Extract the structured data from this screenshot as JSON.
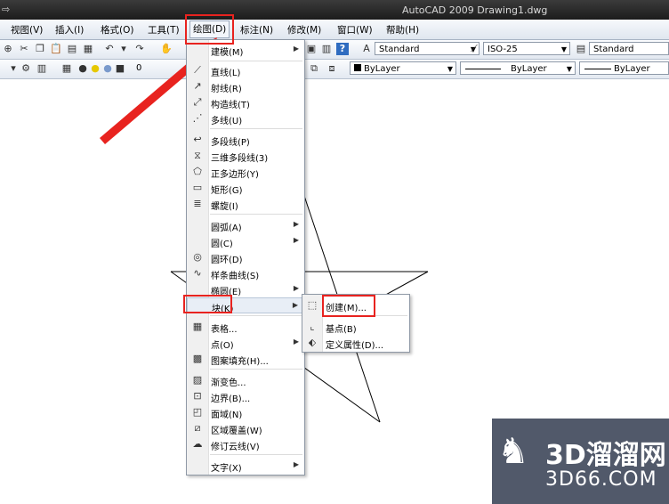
{
  "window": {
    "title": "AutoCAD 2009  Drawing1.dwg"
  },
  "menubar": {
    "items": [
      "视图(V)",
      "插入(I)",
      "格式(O)",
      "工具(T)",
      "绘图(D)",
      "标注(N)",
      "修改(M)",
      "窗口(W)",
      "帮助(H)"
    ],
    "active": "绘图(D)"
  },
  "toolbar1": {
    "text_style": "Standard",
    "dim_style": "ISO-25",
    "table_style": "Standard"
  },
  "toolbar2": {
    "layer_name": "0",
    "color": "ByLayer",
    "linetype": "ByLayer",
    "lineweight": "ByLayer"
  },
  "draw_menu": {
    "items": [
      {
        "label": "建模(M)",
        "icon": "modeling-icon",
        "submenu": true
      },
      {
        "label": "直线(L)",
        "icon": "line-icon"
      },
      {
        "label": "射线(R)",
        "icon": "ray-icon"
      },
      {
        "label": "构造线(T)",
        "icon": "construction-line-icon"
      },
      {
        "label": "多线(U)",
        "icon": "multiline-icon"
      },
      {
        "label": "多段线(P)",
        "icon": "polyline-icon"
      },
      {
        "label": "三维多段线(3)",
        "icon": "3d-polyline-icon"
      },
      {
        "label": "正多边形(Y)",
        "icon": "polygon-icon"
      },
      {
        "label": "矩形(G)",
        "icon": "rectangle-icon"
      },
      {
        "label": "螺旋(I)",
        "icon": "helix-icon"
      },
      {
        "label": "圆弧(A)",
        "icon": "",
        "submenu": true
      },
      {
        "label": "圆(C)",
        "icon": "",
        "submenu": true
      },
      {
        "label": "圆环(D)",
        "icon": "donut-icon"
      },
      {
        "label": "样条曲线(S)",
        "icon": "spline-icon"
      },
      {
        "label": "椭圆(E)",
        "icon": "",
        "submenu": true
      },
      {
        "label": "块(K)",
        "icon": "",
        "submenu": true
      },
      {
        "label": "表格...",
        "icon": "table-icon"
      },
      {
        "label": "点(O)",
        "icon": "",
        "submenu": true
      },
      {
        "label": "图案填充(H)...",
        "icon": "hatch-icon"
      },
      {
        "label": "渐变色...",
        "icon": "gradient-icon"
      },
      {
        "label": "边界(B)...",
        "icon": "boundary-icon"
      },
      {
        "label": "面域(N)",
        "icon": "region-icon"
      },
      {
        "label": "区域覆盖(W)",
        "icon": "wipeout-icon"
      },
      {
        "label": "修订云线(V)",
        "icon": "revcloud-icon"
      },
      {
        "label": "文字(X)",
        "icon": "",
        "submenu": true
      }
    ]
  },
  "block_submenu": {
    "items": [
      {
        "label": "创建(M)...",
        "icon": "block-create-icon"
      },
      {
        "label": "基点(B)",
        "icon": "base-point-icon"
      },
      {
        "label": "定义属性(D)...",
        "icon": "define-attribute-icon"
      }
    ]
  },
  "watermark": {
    "brand": "3D溜溜网",
    "domain": "3D66.COM"
  },
  "colors": {
    "highlight_box": "#e8231f",
    "menubar": "#dfe6ef",
    "titlebar": "#2a2a2a"
  }
}
